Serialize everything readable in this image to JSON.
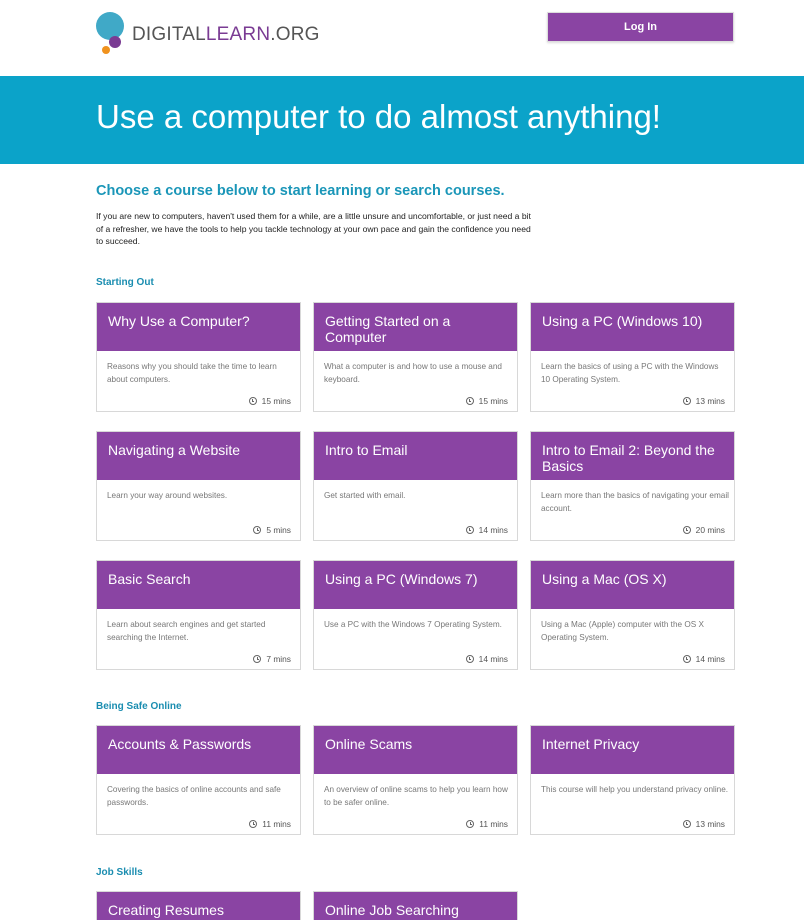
{
  "header": {
    "logo": {
      "prefix": "DIGITAL",
      "mid": "LEARN",
      "suffix": ".ORG"
    },
    "login_label": "Log In"
  },
  "banner": {
    "title": "Use a computer to do almost anything!"
  },
  "intro": {
    "heading": "Choose a course below to start learning or search courses.",
    "text": "If you are new to computers, haven't used them for a while, are a little unsure and uncomfortable, or just need a bit of a refresher, we have the tools to help you tackle technology at your own pace and gain the confidence you need to succeed."
  },
  "sections": [
    {
      "title": "Starting Out",
      "courses": [
        {
          "title": "Why Use a Computer?",
          "desc": "Reasons why you should take the time to learn about computers.",
          "time": "15 mins"
        },
        {
          "title": "Getting Started on a Computer",
          "desc": "What a computer is and how to use a mouse and keyboard.",
          "time": "15 mins"
        },
        {
          "title": "Using a PC (Windows 10)",
          "desc": "Learn the basics of using a PC with the Windows 10 Operating System.",
          "time": "13 mins"
        },
        {
          "title": "Navigating a Website",
          "desc": "Learn your way around websites.",
          "time": "5 mins"
        },
        {
          "title": "Intro to Email",
          "desc": "Get started with email.",
          "time": "14 mins"
        },
        {
          "title": "Intro to Email 2: Beyond the Basics",
          "desc": "Learn more than the basics of navigating your email account.",
          "time": "20 mins"
        },
        {
          "title": "Basic Search",
          "desc": "Learn about search engines and get started searching the Internet.",
          "time": "7 mins"
        },
        {
          "title": "Using a PC (Windows 7)",
          "desc": "Use a PC with the Windows 7 Operating System.",
          "time": "14 mins"
        },
        {
          "title": "Using a Mac (OS X)",
          "desc": "Using a Mac (Apple) computer with the OS X Operating System.",
          "time": "14 mins"
        }
      ]
    },
    {
      "title": "Being Safe Online",
      "courses": [
        {
          "title": "Accounts & Passwords",
          "desc": "Covering the basics of online accounts and safe passwords.",
          "time": "11 mins"
        },
        {
          "title": "Online Scams",
          "desc": "An overview of online scams to help you learn how to be safer online.",
          "time": "11 mins"
        },
        {
          "title": "Internet Privacy",
          "desc": "This course will help you understand privacy online.",
          "time": "13 mins"
        }
      ]
    },
    {
      "title": "Job Skills",
      "courses": [
        {
          "title": "Creating Resumes"
        },
        {
          "title": "Online Job Searching"
        }
      ]
    }
  ]
}
